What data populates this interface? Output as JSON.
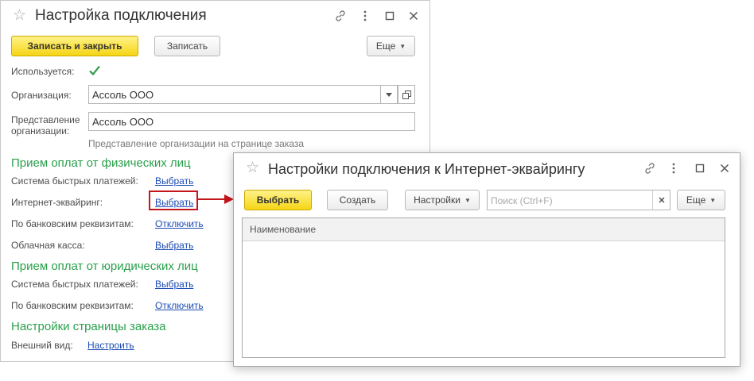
{
  "main_window": {
    "title": "Настройка подключения",
    "toolbar": {
      "save_close_label": "Записать и закрыть",
      "save_label": "Записать",
      "more_label": "Еще"
    },
    "used_label": "Используется:",
    "used_checked": true,
    "organization_label": "Организация:",
    "organization_value": "Ассоль ООО",
    "representation_label_1": "Представление",
    "representation_label_2": "организации:",
    "representation_value": "Ассоль ООО",
    "representation_hint": "Представление организации на странице заказа",
    "sections": {
      "individuals": {
        "title": "Прием оплат от физических лиц",
        "fast_payments_label": "Система быстрых платежей:",
        "fast_payments_action": "Выбрать",
        "acquiring_label": "Интернет-эквайринг:",
        "acquiring_action": "Выбрать",
        "bank_details_label": "По банковским реквизитам:",
        "bank_details_action": "Отключить",
        "cloud_cash_label": "Облачная касса:",
        "cloud_cash_action": "Выбрать"
      },
      "legal": {
        "title": "Прием оплат от юридических лиц",
        "fast_payments_label": "Система быстрых платежей:",
        "fast_payments_action": "Выбрать",
        "bank_details_label": "По банковским реквизитам:",
        "bank_details_action": "Отключить"
      },
      "order_page": {
        "title": "Настройки страницы заказа",
        "appearance_label": "Внешний вид:",
        "appearance_action": "Настроить"
      }
    }
  },
  "dialog": {
    "title": "Настройки подключения к Интернет-эквайрингу",
    "toolbar": {
      "select_label": "Выбрать",
      "create_label": "Создать",
      "settings_label": "Настройки",
      "search_placeholder": "Поиск (Ctrl+F)",
      "more_label": "Еще"
    },
    "table": {
      "columns": [
        "Наименование"
      ],
      "rows": []
    }
  },
  "colors": {
    "primary_button": "#f5d515",
    "section_title": "#2aa14c",
    "link": "#1c4bb5",
    "highlight": "#c4161c"
  },
  "icons": [
    "star-icon",
    "link-icon",
    "more-vert-icon",
    "maximize-icon",
    "close-icon",
    "checkmark-icon",
    "dropdown-arrow-icon",
    "open-form-icon",
    "clear-icon",
    "arrow-right-icon"
  ]
}
